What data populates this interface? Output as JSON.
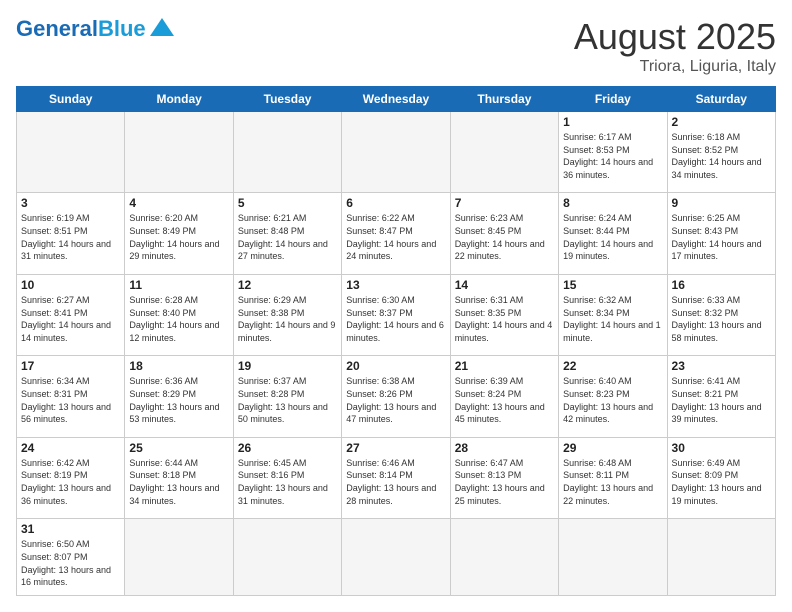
{
  "header": {
    "logo_general": "General",
    "logo_blue": "Blue",
    "month_year": "August 2025",
    "location": "Triora, Liguria, Italy"
  },
  "weekdays": [
    "Sunday",
    "Monday",
    "Tuesday",
    "Wednesday",
    "Thursday",
    "Friday",
    "Saturday"
  ],
  "weeks": [
    [
      {
        "day": "",
        "info": ""
      },
      {
        "day": "",
        "info": ""
      },
      {
        "day": "",
        "info": ""
      },
      {
        "day": "",
        "info": ""
      },
      {
        "day": "",
        "info": ""
      },
      {
        "day": "1",
        "info": "Sunrise: 6:17 AM\nSunset: 8:53 PM\nDaylight: 14 hours and 36 minutes."
      },
      {
        "day": "2",
        "info": "Sunrise: 6:18 AM\nSunset: 8:52 PM\nDaylight: 14 hours and 34 minutes."
      }
    ],
    [
      {
        "day": "3",
        "info": "Sunrise: 6:19 AM\nSunset: 8:51 PM\nDaylight: 14 hours and 31 minutes."
      },
      {
        "day": "4",
        "info": "Sunrise: 6:20 AM\nSunset: 8:49 PM\nDaylight: 14 hours and 29 minutes."
      },
      {
        "day": "5",
        "info": "Sunrise: 6:21 AM\nSunset: 8:48 PM\nDaylight: 14 hours and 27 minutes."
      },
      {
        "day": "6",
        "info": "Sunrise: 6:22 AM\nSunset: 8:47 PM\nDaylight: 14 hours and 24 minutes."
      },
      {
        "day": "7",
        "info": "Sunrise: 6:23 AM\nSunset: 8:45 PM\nDaylight: 14 hours and 22 minutes."
      },
      {
        "day": "8",
        "info": "Sunrise: 6:24 AM\nSunset: 8:44 PM\nDaylight: 14 hours and 19 minutes."
      },
      {
        "day": "9",
        "info": "Sunrise: 6:25 AM\nSunset: 8:43 PM\nDaylight: 14 hours and 17 minutes."
      }
    ],
    [
      {
        "day": "10",
        "info": "Sunrise: 6:27 AM\nSunset: 8:41 PM\nDaylight: 14 hours and 14 minutes."
      },
      {
        "day": "11",
        "info": "Sunrise: 6:28 AM\nSunset: 8:40 PM\nDaylight: 14 hours and 12 minutes."
      },
      {
        "day": "12",
        "info": "Sunrise: 6:29 AM\nSunset: 8:38 PM\nDaylight: 14 hours and 9 minutes."
      },
      {
        "day": "13",
        "info": "Sunrise: 6:30 AM\nSunset: 8:37 PM\nDaylight: 14 hours and 6 minutes."
      },
      {
        "day": "14",
        "info": "Sunrise: 6:31 AM\nSunset: 8:35 PM\nDaylight: 14 hours and 4 minutes."
      },
      {
        "day": "15",
        "info": "Sunrise: 6:32 AM\nSunset: 8:34 PM\nDaylight: 14 hours and 1 minute."
      },
      {
        "day": "16",
        "info": "Sunrise: 6:33 AM\nSunset: 8:32 PM\nDaylight: 13 hours and 58 minutes."
      }
    ],
    [
      {
        "day": "17",
        "info": "Sunrise: 6:34 AM\nSunset: 8:31 PM\nDaylight: 13 hours and 56 minutes."
      },
      {
        "day": "18",
        "info": "Sunrise: 6:36 AM\nSunset: 8:29 PM\nDaylight: 13 hours and 53 minutes."
      },
      {
        "day": "19",
        "info": "Sunrise: 6:37 AM\nSunset: 8:28 PM\nDaylight: 13 hours and 50 minutes."
      },
      {
        "day": "20",
        "info": "Sunrise: 6:38 AM\nSunset: 8:26 PM\nDaylight: 13 hours and 47 minutes."
      },
      {
        "day": "21",
        "info": "Sunrise: 6:39 AM\nSunset: 8:24 PM\nDaylight: 13 hours and 45 minutes."
      },
      {
        "day": "22",
        "info": "Sunrise: 6:40 AM\nSunset: 8:23 PM\nDaylight: 13 hours and 42 minutes."
      },
      {
        "day": "23",
        "info": "Sunrise: 6:41 AM\nSunset: 8:21 PM\nDaylight: 13 hours and 39 minutes."
      }
    ],
    [
      {
        "day": "24",
        "info": "Sunrise: 6:42 AM\nSunset: 8:19 PM\nDaylight: 13 hours and 36 minutes."
      },
      {
        "day": "25",
        "info": "Sunrise: 6:44 AM\nSunset: 8:18 PM\nDaylight: 13 hours and 34 minutes."
      },
      {
        "day": "26",
        "info": "Sunrise: 6:45 AM\nSunset: 8:16 PM\nDaylight: 13 hours and 31 minutes."
      },
      {
        "day": "27",
        "info": "Sunrise: 6:46 AM\nSunset: 8:14 PM\nDaylight: 13 hours and 28 minutes."
      },
      {
        "day": "28",
        "info": "Sunrise: 6:47 AM\nSunset: 8:13 PM\nDaylight: 13 hours and 25 minutes."
      },
      {
        "day": "29",
        "info": "Sunrise: 6:48 AM\nSunset: 8:11 PM\nDaylight: 13 hours and 22 minutes."
      },
      {
        "day": "30",
        "info": "Sunrise: 6:49 AM\nSunset: 8:09 PM\nDaylight: 13 hours and 19 minutes."
      }
    ],
    [
      {
        "day": "31",
        "info": "Sunrise: 6:50 AM\nSunset: 8:07 PM\nDaylight: 13 hours and 16 minutes."
      },
      {
        "day": "",
        "info": ""
      },
      {
        "day": "",
        "info": ""
      },
      {
        "day": "",
        "info": ""
      },
      {
        "day": "",
        "info": ""
      },
      {
        "day": "",
        "info": ""
      },
      {
        "day": "",
        "info": ""
      }
    ]
  ]
}
